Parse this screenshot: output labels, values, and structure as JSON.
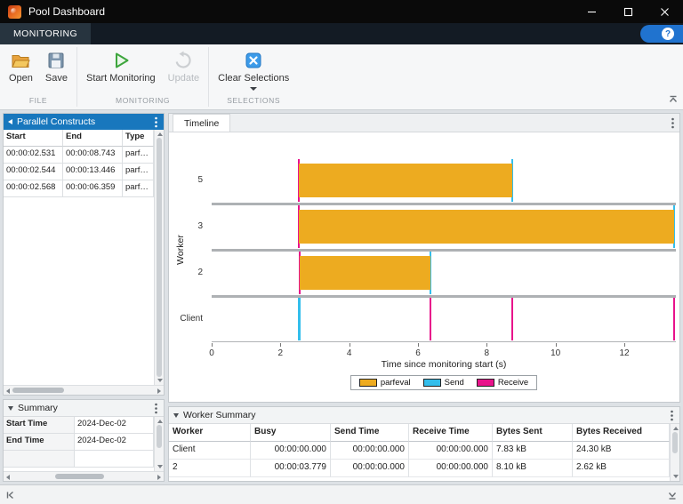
{
  "window": {
    "title": "Pool Dashboard"
  },
  "ribbon": {
    "tab_label": "MONITORING",
    "help_label": "?"
  },
  "toolbar": {
    "file": {
      "label": "FILE",
      "open": "Open",
      "save": "Save"
    },
    "monitoring": {
      "label": "MONITORING",
      "start": "Start Monitoring",
      "update": "Update"
    },
    "selections": {
      "label": "SELECTIONS",
      "clear": "Clear Selections"
    }
  },
  "constructs_panel": {
    "title": "Parallel Constructs",
    "columns": {
      "start": "Start",
      "end": "End",
      "type": "Type"
    },
    "rows": [
      {
        "start": "00:00:02.531",
        "end": "00:00:08.743",
        "type": "parfeval"
      },
      {
        "start": "00:00:02.544",
        "end": "00:00:13.446",
        "type": "parfeval"
      },
      {
        "start": "00:00:02.568",
        "end": "00:00:06.359",
        "type": "parfeval"
      }
    ]
  },
  "summary_panel": {
    "title": "Summary",
    "rows": [
      {
        "label": "Start Time",
        "value": "2024-Dec-02"
      },
      {
        "label": "End Time",
        "value": "2024-Dec-02"
      }
    ]
  },
  "timeline_panel": {
    "tab_label": "Timeline"
  },
  "chart_data": {
    "type": "bar",
    "subtype": "timeline-gantt",
    "ylabel": "Worker",
    "xlabel": "Time since monitoring start (s)",
    "xlim": [
      0,
      13.5
    ],
    "xticks": [
      0,
      2,
      4,
      6,
      8,
      10,
      12
    ],
    "lanes": [
      "5",
      "3",
      "2",
      "Client"
    ],
    "bars": [
      {
        "lane": "5",
        "start": 2.531,
        "end": 8.743,
        "type": "parfeval"
      },
      {
        "lane": "3",
        "start": 2.544,
        "end": 13.446,
        "type": "parfeval"
      },
      {
        "lane": "2",
        "start": 2.568,
        "end": 6.359,
        "type": "parfeval"
      }
    ],
    "events": [
      {
        "lane": "5",
        "time": 2.531,
        "kind": "receive"
      },
      {
        "lane": "5",
        "time": 8.743,
        "kind": "send"
      },
      {
        "lane": "3",
        "time": 2.544,
        "kind": "receive"
      },
      {
        "lane": "3",
        "time": 13.446,
        "kind": "send"
      },
      {
        "lane": "2",
        "time": 2.568,
        "kind": "receive"
      },
      {
        "lane": "2",
        "time": 6.359,
        "kind": "send"
      },
      {
        "lane": "Client",
        "time": 2.531,
        "kind": "send"
      },
      {
        "lane": "Client",
        "time": 2.544,
        "kind": "send"
      },
      {
        "lane": "Client",
        "time": 2.568,
        "kind": "send"
      },
      {
        "lane": "Client",
        "time": 6.359,
        "kind": "receive"
      },
      {
        "lane": "Client",
        "time": 8.743,
        "kind": "receive"
      },
      {
        "lane": "Client",
        "time": 13.446,
        "kind": "receive"
      }
    ],
    "legend": [
      {
        "label": "parfeval",
        "color": "#EDAB20"
      },
      {
        "label": "Send",
        "color": "#33BEEC"
      },
      {
        "label": "Receive",
        "color": "#E8128B"
      }
    ],
    "grid": false,
    "legend_position": "below"
  },
  "worker_summary": {
    "title": "Worker Summary",
    "columns": [
      "Worker",
      "Busy",
      "Send Time",
      "Receive Time",
      "Bytes Sent",
      "Bytes Received"
    ],
    "rows": [
      {
        "worker": "Client",
        "busy": "00:00:00.000",
        "send_time": "00:00:00.000",
        "receive_time": "00:00:00.000",
        "bytes_sent": "7.83 kB",
        "bytes_received": "24.30 kB"
      },
      {
        "worker": "2",
        "busy": "00:00:03.779",
        "send_time": "00:00:00.000",
        "receive_time": "00:00:00.000",
        "bytes_sent": "8.10 kB",
        "bytes_received": "2.62 kB"
      }
    ]
  },
  "colors": {
    "parfeval": "#EDAB20",
    "send": "#33BEEC",
    "receive": "#E8128B",
    "header_blue": "#1877BD",
    "accent_blue": "#2073CF"
  }
}
